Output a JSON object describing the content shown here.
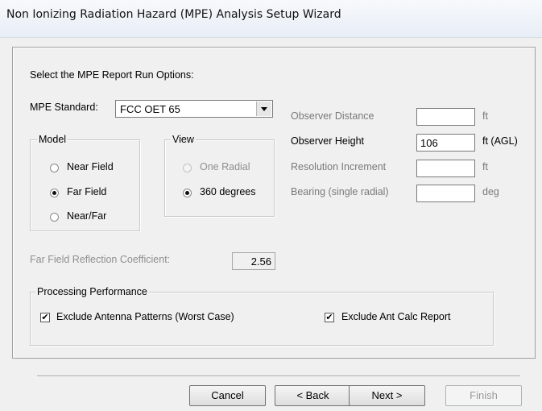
{
  "window": {
    "title": "Non Ionizing Radiation Hazard (MPE) Analysis Setup Wizard"
  },
  "main": {
    "prompt": "Select the MPE Report Run Options:",
    "mpe_standard": {
      "label": "MPE Standard:",
      "value": "FCC OET 65"
    },
    "model": {
      "legend": "Model",
      "options": [
        {
          "label": "Near Field",
          "selected": false
        },
        {
          "label": "Far Field",
          "selected": true
        },
        {
          "label": "Near/Far",
          "selected": false
        }
      ]
    },
    "view": {
      "legend": "View",
      "options": [
        {
          "label": "One Radial",
          "selected": false,
          "enabled": false
        },
        {
          "label": "360 degrees",
          "selected": true,
          "enabled": true
        }
      ]
    },
    "fields": [
      {
        "label": "Observer Distance",
        "value": "",
        "unit": "ft",
        "enabled": false
      },
      {
        "label": "Observer Height",
        "value": "106",
        "unit": "ft (AGL)",
        "enabled": true
      },
      {
        "label": "Resolution Increment",
        "value": "",
        "unit": "ft",
        "enabled": false
      },
      {
        "label": "Bearing (single radial)",
        "value": "",
        "unit": "deg",
        "enabled": false
      }
    ],
    "reflection": {
      "label": "Far Field Reflection Coefficient:",
      "value": "2.56"
    },
    "processing": {
      "legend": "Processing Performance",
      "exclude_patterns": {
        "label": "Exclude Antenna Patterns (Worst Case)",
        "checked": true
      },
      "exclude_report": {
        "label": "Exclude Ant Calc Report",
        "checked": true
      }
    }
  },
  "buttons": {
    "cancel": "Cancel",
    "back": "< Back",
    "next": "Next >",
    "finish": "Finish"
  }
}
